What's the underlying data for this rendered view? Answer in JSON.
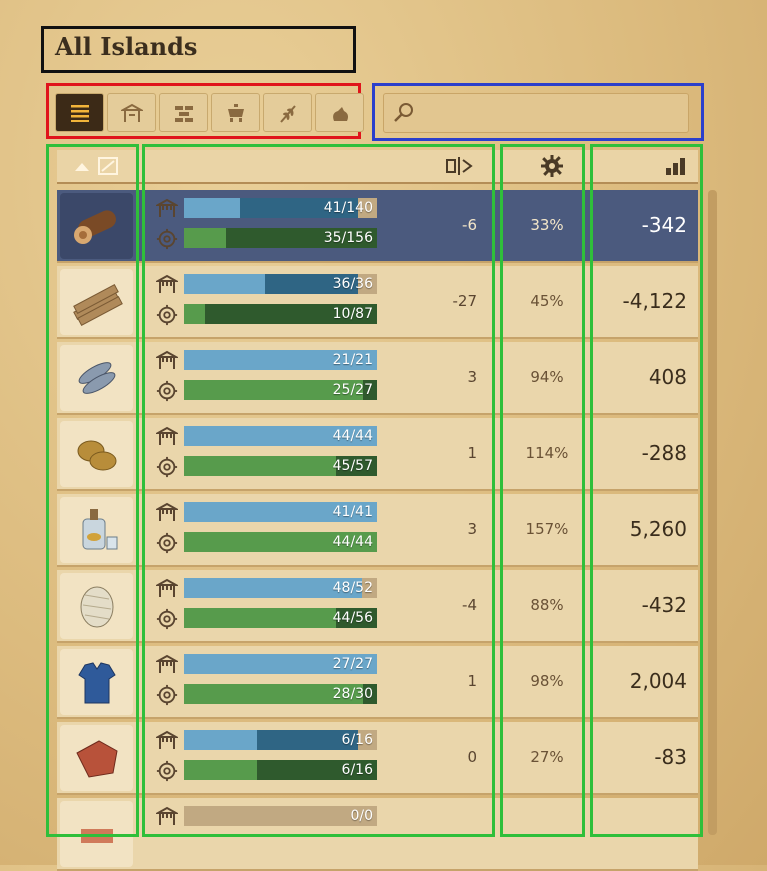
{
  "title": "All Islands",
  "filters": [
    {
      "icon": "list-icon",
      "active": true
    },
    {
      "icon": "market-stall-icon",
      "active": false
    },
    {
      "icon": "bricks-icon",
      "active": false
    },
    {
      "icon": "pot-icon",
      "active": false
    },
    {
      "icon": "wheat-icon",
      "active": false
    },
    {
      "icon": "pouch-icon",
      "active": false
    }
  ],
  "search": {
    "placeholder": ""
  },
  "colors": {
    "annotation_title": "#111111",
    "annotation_filters": "#e0141b",
    "annotation_search": "#2b3fcc",
    "annotation_columns": "#2fbf3a",
    "market_fill": "#6aa6c9",
    "production_fill": "#579b4c",
    "selected_row": "#4b5a7e"
  },
  "rows": [
    {
      "good": "wood-logs-icon",
      "market": "41/140",
      "market_frac": 0.29,
      "production": "35/156",
      "production_frac": 0.22,
      "change": "-6",
      "productivity": "33%",
      "balance": "-342",
      "selected": true
    },
    {
      "good": "planks-icon",
      "market": "36/36",
      "market_frac": 0.42,
      "production": "10/87",
      "production_frac": 0.11,
      "change": "-27",
      "productivity": "45%",
      "balance": "-4,122",
      "selected": false
    },
    {
      "good": "fish-icon",
      "market": "21/21",
      "market_frac": 1.0,
      "production": "25/27",
      "production_frac": 0.93,
      "change": "3",
      "productivity": "94%",
      "balance": "408",
      "selected": false
    },
    {
      "good": "potatoes-icon",
      "market": "44/44",
      "market_frac": 1.0,
      "production": "45/57",
      "production_frac": 0.79,
      "change": "1",
      "productivity": "114%",
      "balance": "-288",
      "selected": false
    },
    {
      "good": "schnapps-icon",
      "market": "41/41",
      "market_frac": 1.0,
      "production": "44/44",
      "production_frac": 1.0,
      "change": "3",
      "productivity": "157%",
      "balance": "5,260",
      "selected": false
    },
    {
      "good": "wool-icon",
      "market": "48/52",
      "market_frac": 0.92,
      "production": "44/56",
      "production_frac": 0.79,
      "change": "-4",
      "productivity": "88%",
      "balance": "-432",
      "selected": false
    },
    {
      "good": "work-clothes-icon",
      "market": "27/27",
      "market_frac": 1.0,
      "production": "28/30",
      "production_frac": 0.93,
      "change": "1",
      "productivity": "98%",
      "balance": "2,004",
      "selected": false
    },
    {
      "good": "clay-icon",
      "market": "6/16",
      "market_frac": 0.38,
      "production": "6/16",
      "production_frac": 0.38,
      "change": "0",
      "productivity": "27%",
      "balance": "-83",
      "selected": false
    },
    {
      "good": "bricks-good-icon",
      "market": "0/0",
      "market_frac": 0,
      "production": "",
      "production_frac": 0,
      "change": "",
      "productivity": "",
      "balance": "",
      "selected": false
    }
  ]
}
